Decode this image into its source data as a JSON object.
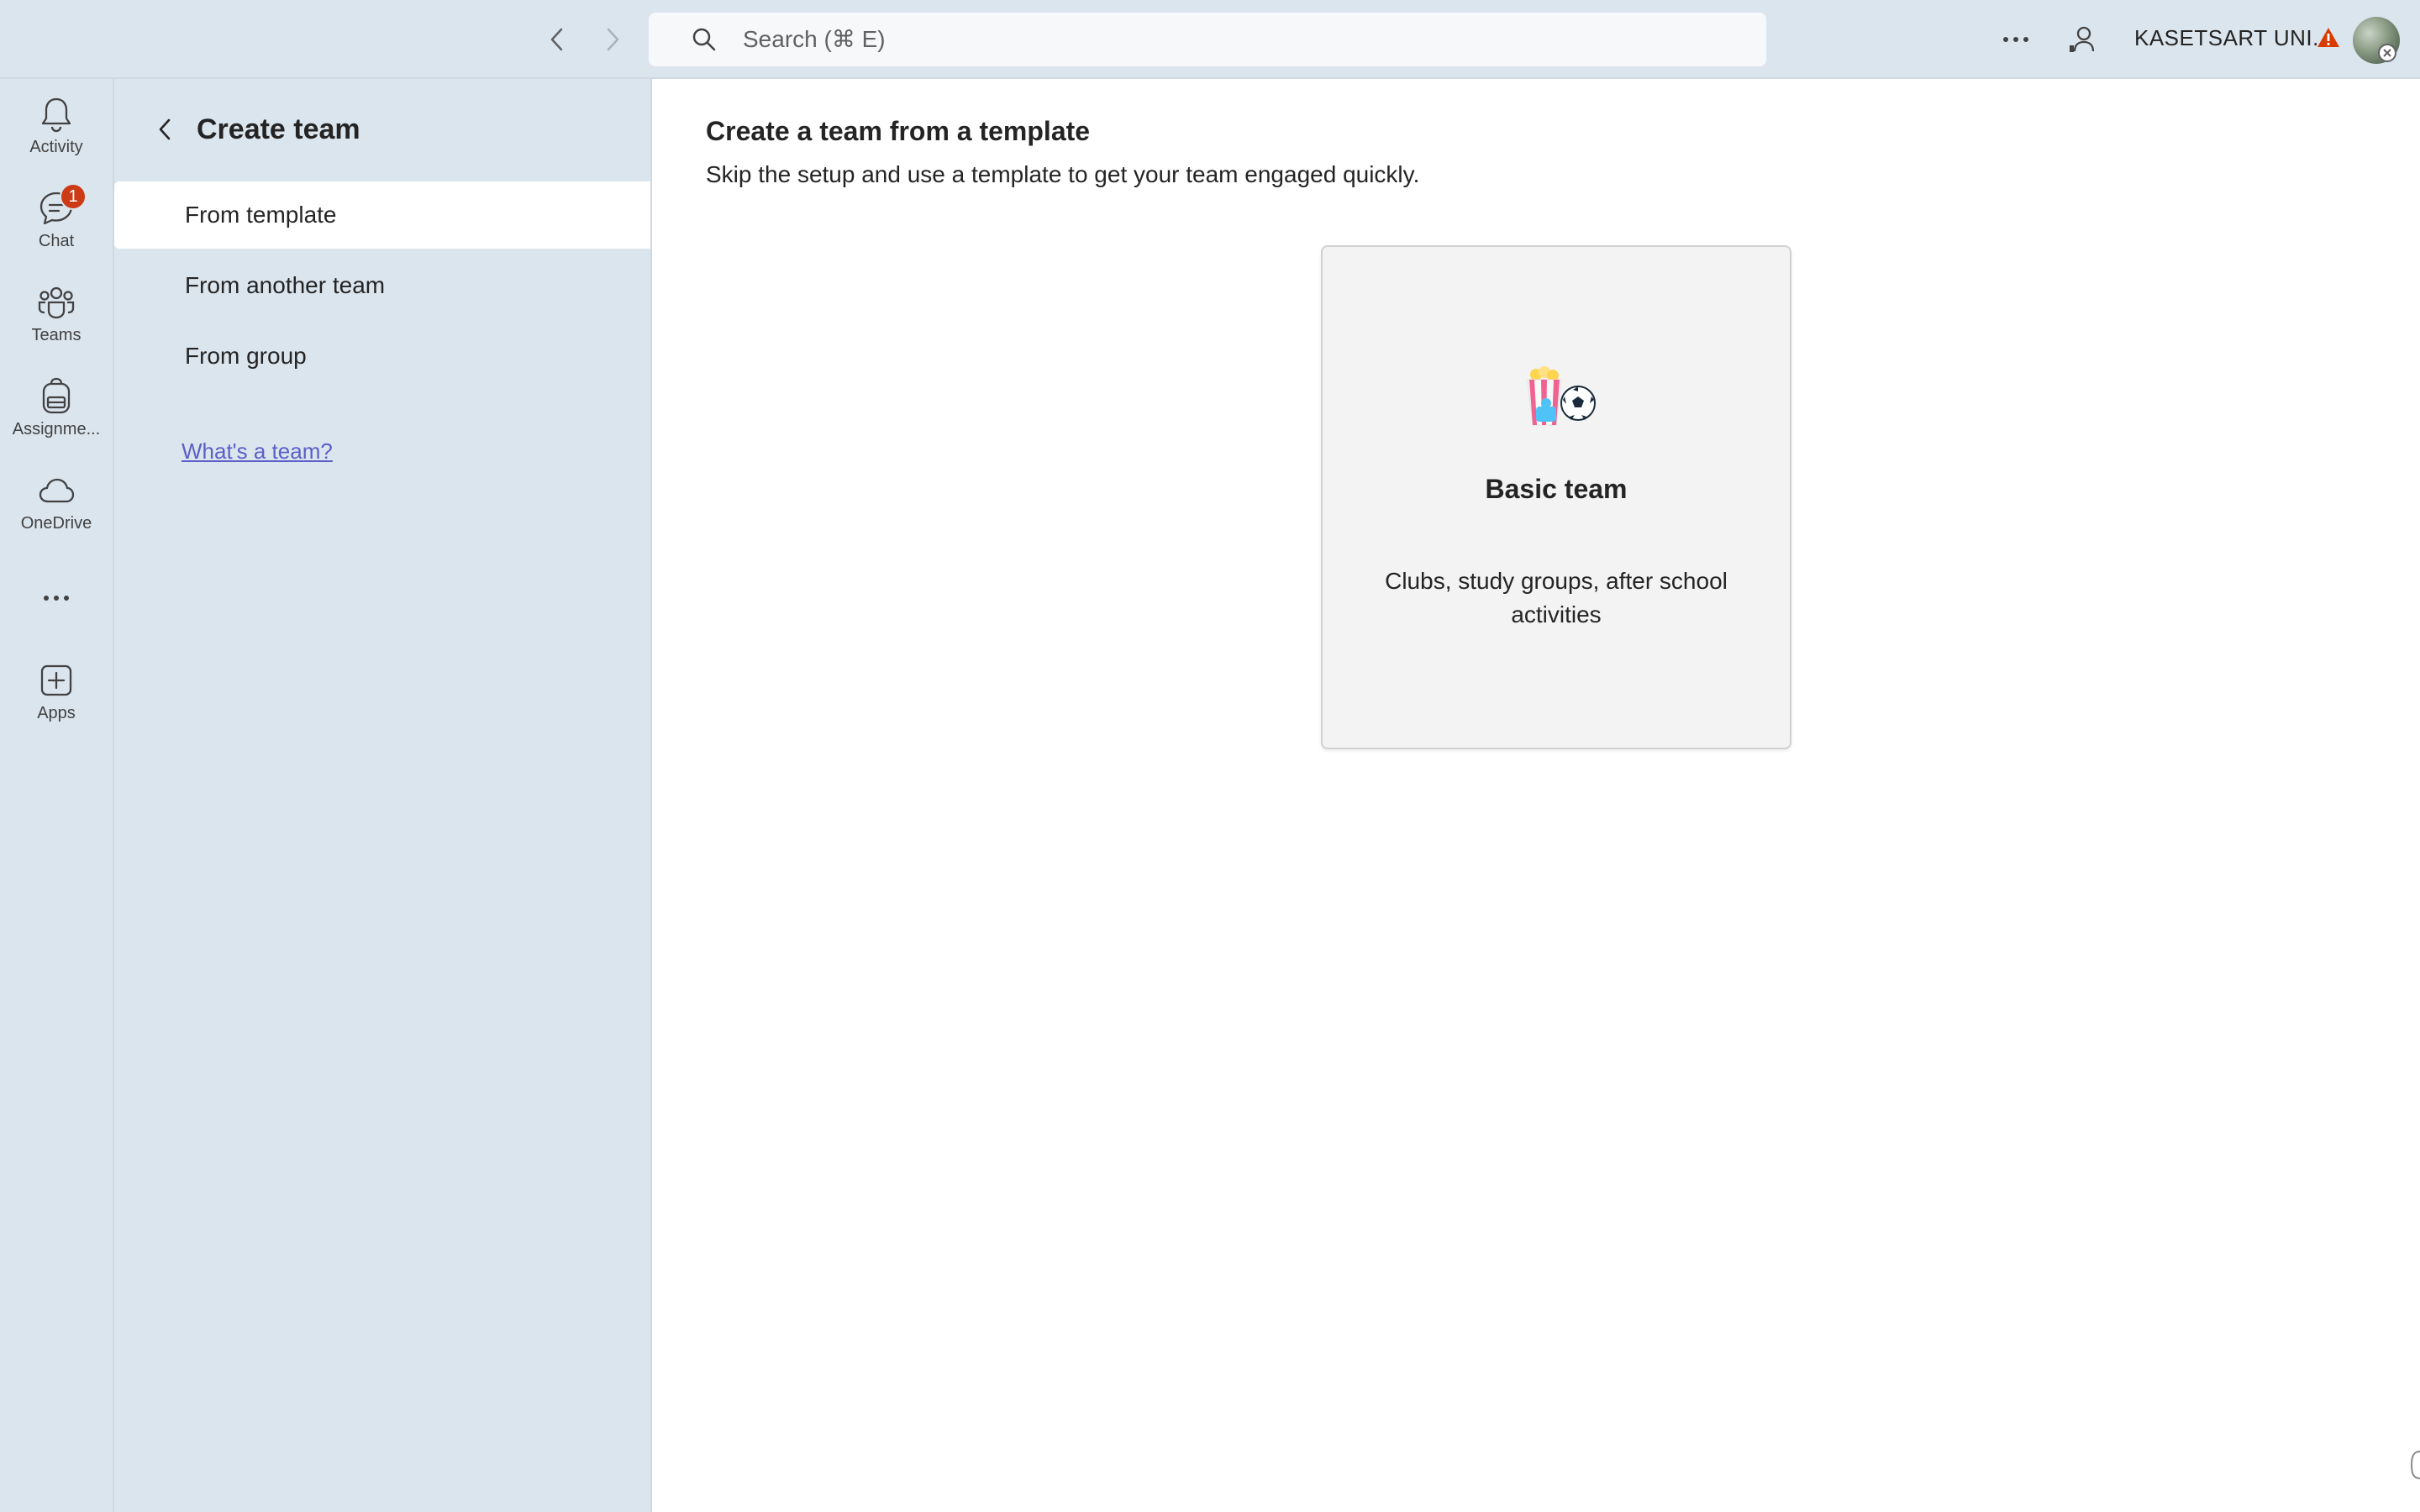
{
  "topbar": {
    "search_placeholder": "Search (⌘ E)",
    "org_name": "KASETSART UNI...",
    "icons": {
      "back": "chevron-left-icon",
      "forward": "chevron-right-icon",
      "search": "search-icon",
      "more": "more-horizontal-icon",
      "presence": "person-icon",
      "warning": "warning-icon"
    }
  },
  "rail": {
    "items": [
      {
        "label": "Activity",
        "icon": "bell-icon"
      },
      {
        "label": "Chat",
        "icon": "chat-icon",
        "badge": "1"
      },
      {
        "label": "Teams",
        "icon": "teams-icon"
      },
      {
        "label": "Assignme...",
        "icon": "backpack-icon"
      },
      {
        "label": "OneDrive",
        "icon": "cloud-icon"
      },
      {
        "label": "",
        "icon": "more-horizontal-icon"
      },
      {
        "label": "Apps",
        "icon": "add-app-icon"
      }
    ]
  },
  "panel": {
    "title": "Create team",
    "options": [
      {
        "label": "From template",
        "selected": true
      },
      {
        "label": "From another team",
        "selected": false
      },
      {
        "label": "From group",
        "selected": false
      }
    ],
    "help_link": "What's a team?"
  },
  "main": {
    "title": "Create a team from a template",
    "subtitle": "Skip the setup and use a template to get your team engaged quickly.",
    "templates": [
      {
        "title": "Basic team",
        "description": "Clubs, study groups, after school activities",
        "icon": "popcorn-soccer-icon"
      }
    ]
  },
  "colors": {
    "chrome_bg": "#dbe5ee",
    "main_bg": "#ffffff",
    "accent_link": "#5b5fc7",
    "badge": "#cc3a16",
    "warning": "#d83b01",
    "card_bg": "#f3f3f3"
  }
}
